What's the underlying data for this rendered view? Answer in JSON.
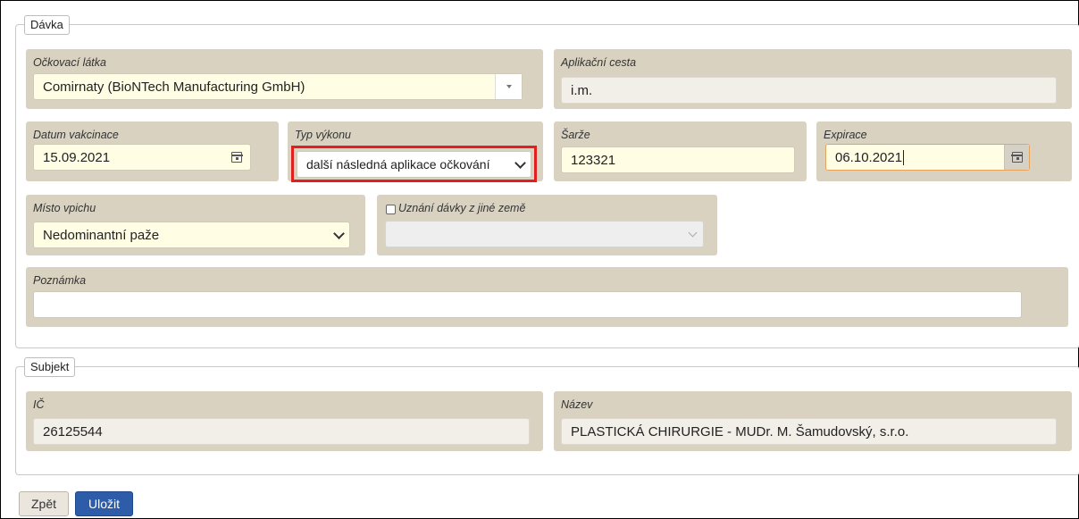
{
  "davka": {
    "legend": "Dávka",
    "ockovaci_latka": {
      "label": "Očkovací látka",
      "value": "Comirnaty (BioNTech Manufacturing GmbH)"
    },
    "aplikacni_cesta": {
      "label": "Aplikační cesta",
      "value": "i.m."
    },
    "datum_vakcinace": {
      "label": "Datum vakcinace",
      "value": "15.09.2021"
    },
    "typ_vykonu": {
      "label": "Typ výkonu",
      "value": "další následná aplikace očkování",
      "highlight_color": "#e02020"
    },
    "sarze": {
      "label": "Šarže",
      "value": "123321"
    },
    "expirace": {
      "label": "Expirace",
      "value": "06.10.2021"
    },
    "misto_vpichu": {
      "label": "Místo vpichu",
      "value": "Nedominantní paže"
    },
    "uznani_davky": {
      "label": "Uznání dávky z jiné země",
      "checked": false,
      "value": ""
    },
    "poznamka": {
      "label": "Poznámka",
      "value": ""
    }
  },
  "subjekt": {
    "legend": "Subjekt",
    "ic": {
      "label": "IČ",
      "value": "26125544"
    },
    "nazev": {
      "label": "Název",
      "value": "PLASTICKÁ CHIRURGIE - MUDr. M. Šamudovský, s.r.o."
    }
  },
  "buttons": {
    "back": "Zpět",
    "save": "Uložit"
  },
  "colors": {
    "group_bg": "#d9d2c1",
    "input_bg": "#fffde4",
    "primary": "#2d5da8"
  }
}
